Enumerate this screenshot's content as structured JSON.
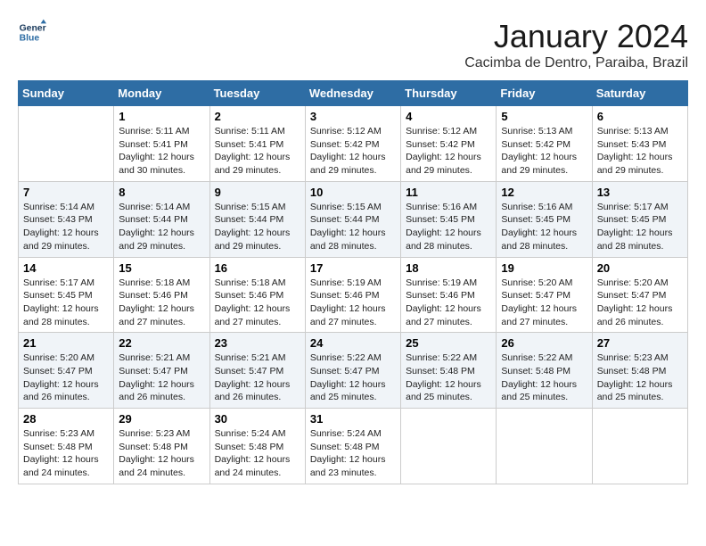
{
  "header": {
    "logo_line1": "General",
    "logo_line2": "Blue",
    "month_title": "January 2024",
    "location": "Cacimba de Dentro, Paraiba, Brazil"
  },
  "days_of_week": [
    "Sunday",
    "Monday",
    "Tuesday",
    "Wednesday",
    "Thursday",
    "Friday",
    "Saturday"
  ],
  "weeks": [
    [
      {
        "day": "",
        "sunrise": "",
        "sunset": "",
        "daylight": ""
      },
      {
        "day": "1",
        "sunrise": "5:11 AM",
        "sunset": "5:41 PM",
        "daylight": "12 hours and 30 minutes."
      },
      {
        "day": "2",
        "sunrise": "5:11 AM",
        "sunset": "5:41 PM",
        "daylight": "12 hours and 29 minutes."
      },
      {
        "day": "3",
        "sunrise": "5:12 AM",
        "sunset": "5:42 PM",
        "daylight": "12 hours and 29 minutes."
      },
      {
        "day": "4",
        "sunrise": "5:12 AM",
        "sunset": "5:42 PM",
        "daylight": "12 hours and 29 minutes."
      },
      {
        "day": "5",
        "sunrise": "5:13 AM",
        "sunset": "5:42 PM",
        "daylight": "12 hours and 29 minutes."
      },
      {
        "day": "6",
        "sunrise": "5:13 AM",
        "sunset": "5:43 PM",
        "daylight": "12 hours and 29 minutes."
      }
    ],
    [
      {
        "day": "7",
        "sunrise": "5:14 AM",
        "sunset": "5:43 PM",
        "daylight": "12 hours and 29 minutes."
      },
      {
        "day": "8",
        "sunrise": "5:14 AM",
        "sunset": "5:44 PM",
        "daylight": "12 hours and 29 minutes."
      },
      {
        "day": "9",
        "sunrise": "5:15 AM",
        "sunset": "5:44 PM",
        "daylight": "12 hours and 29 minutes."
      },
      {
        "day": "10",
        "sunrise": "5:15 AM",
        "sunset": "5:44 PM",
        "daylight": "12 hours and 28 minutes."
      },
      {
        "day": "11",
        "sunrise": "5:16 AM",
        "sunset": "5:45 PM",
        "daylight": "12 hours and 28 minutes."
      },
      {
        "day": "12",
        "sunrise": "5:16 AM",
        "sunset": "5:45 PM",
        "daylight": "12 hours and 28 minutes."
      },
      {
        "day": "13",
        "sunrise": "5:17 AM",
        "sunset": "5:45 PM",
        "daylight": "12 hours and 28 minutes."
      }
    ],
    [
      {
        "day": "14",
        "sunrise": "5:17 AM",
        "sunset": "5:45 PM",
        "daylight": "12 hours and 28 minutes."
      },
      {
        "day": "15",
        "sunrise": "5:18 AM",
        "sunset": "5:46 PM",
        "daylight": "12 hours and 27 minutes."
      },
      {
        "day": "16",
        "sunrise": "5:18 AM",
        "sunset": "5:46 PM",
        "daylight": "12 hours and 27 minutes."
      },
      {
        "day": "17",
        "sunrise": "5:19 AM",
        "sunset": "5:46 PM",
        "daylight": "12 hours and 27 minutes."
      },
      {
        "day": "18",
        "sunrise": "5:19 AM",
        "sunset": "5:46 PM",
        "daylight": "12 hours and 27 minutes."
      },
      {
        "day": "19",
        "sunrise": "5:20 AM",
        "sunset": "5:47 PM",
        "daylight": "12 hours and 27 minutes."
      },
      {
        "day": "20",
        "sunrise": "5:20 AM",
        "sunset": "5:47 PM",
        "daylight": "12 hours and 26 minutes."
      }
    ],
    [
      {
        "day": "21",
        "sunrise": "5:20 AM",
        "sunset": "5:47 PM",
        "daylight": "12 hours and 26 minutes."
      },
      {
        "day": "22",
        "sunrise": "5:21 AM",
        "sunset": "5:47 PM",
        "daylight": "12 hours and 26 minutes."
      },
      {
        "day": "23",
        "sunrise": "5:21 AM",
        "sunset": "5:47 PM",
        "daylight": "12 hours and 26 minutes."
      },
      {
        "day": "24",
        "sunrise": "5:22 AM",
        "sunset": "5:47 PM",
        "daylight": "12 hours and 25 minutes."
      },
      {
        "day": "25",
        "sunrise": "5:22 AM",
        "sunset": "5:48 PM",
        "daylight": "12 hours and 25 minutes."
      },
      {
        "day": "26",
        "sunrise": "5:22 AM",
        "sunset": "5:48 PM",
        "daylight": "12 hours and 25 minutes."
      },
      {
        "day": "27",
        "sunrise": "5:23 AM",
        "sunset": "5:48 PM",
        "daylight": "12 hours and 25 minutes."
      }
    ],
    [
      {
        "day": "28",
        "sunrise": "5:23 AM",
        "sunset": "5:48 PM",
        "daylight": "12 hours and 24 minutes."
      },
      {
        "day": "29",
        "sunrise": "5:23 AM",
        "sunset": "5:48 PM",
        "daylight": "12 hours and 24 minutes."
      },
      {
        "day": "30",
        "sunrise": "5:24 AM",
        "sunset": "5:48 PM",
        "daylight": "12 hours and 24 minutes."
      },
      {
        "day": "31",
        "sunrise": "5:24 AM",
        "sunset": "5:48 PM",
        "daylight": "12 hours and 23 minutes."
      },
      {
        "day": "",
        "sunrise": "",
        "sunset": "",
        "daylight": ""
      },
      {
        "day": "",
        "sunrise": "",
        "sunset": "",
        "daylight": ""
      },
      {
        "day": "",
        "sunrise": "",
        "sunset": "",
        "daylight": ""
      }
    ]
  ]
}
